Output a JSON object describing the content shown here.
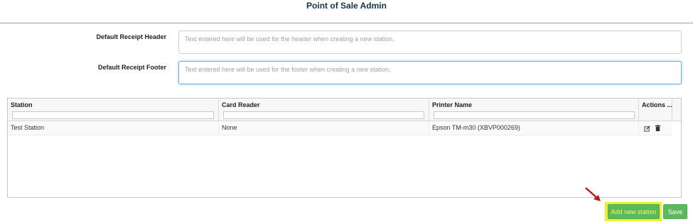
{
  "page": {
    "title": "Point of Sale Admin"
  },
  "receipt": {
    "header_label": "Default Receipt Header",
    "header_placeholder": "Text entered here will be used for the header when creating a new station.",
    "footer_label": "Default Receipt Footer",
    "footer_placeholder": "Text entered here will be used for the footer when creating a new station."
  },
  "grid": {
    "columns": [
      "Station",
      "Card Reader",
      "Printer Name",
      "Actions ..."
    ],
    "rows": [
      {
        "station": "Test Station",
        "card_reader": "None",
        "printer_name": "Epson TM-m30 (XBVP000269)"
      }
    ],
    "action_icons": [
      "edit-icon",
      "delete-icon"
    ]
  },
  "buttons": {
    "add_station": "Add new station",
    "save": "Save"
  },
  "colors": {
    "save_green": "#5cb85c",
    "highlight_yellow": "#eef02a",
    "arrow_red": "#c0161c",
    "title_navy": "#12324a"
  }
}
